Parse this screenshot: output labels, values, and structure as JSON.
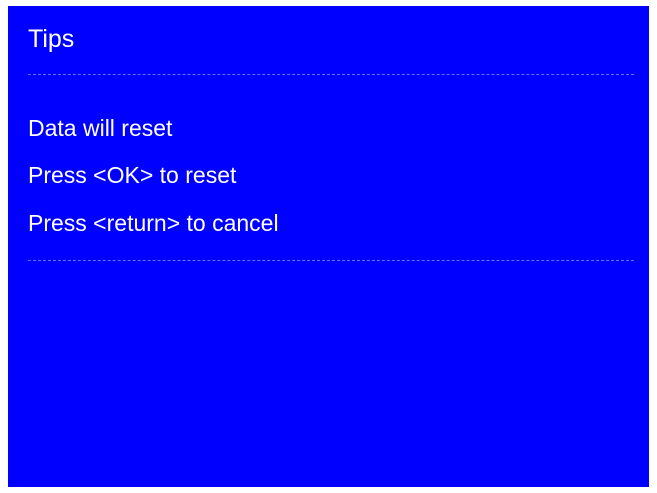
{
  "dialog": {
    "title": "Tips",
    "lines": [
      "Data will reset",
      "Press <OK> to reset",
      "Press <return> to cancel"
    ]
  },
  "colors": {
    "background": "#0000ff",
    "text": "#ffffff",
    "divider": "#5e72ff"
  }
}
